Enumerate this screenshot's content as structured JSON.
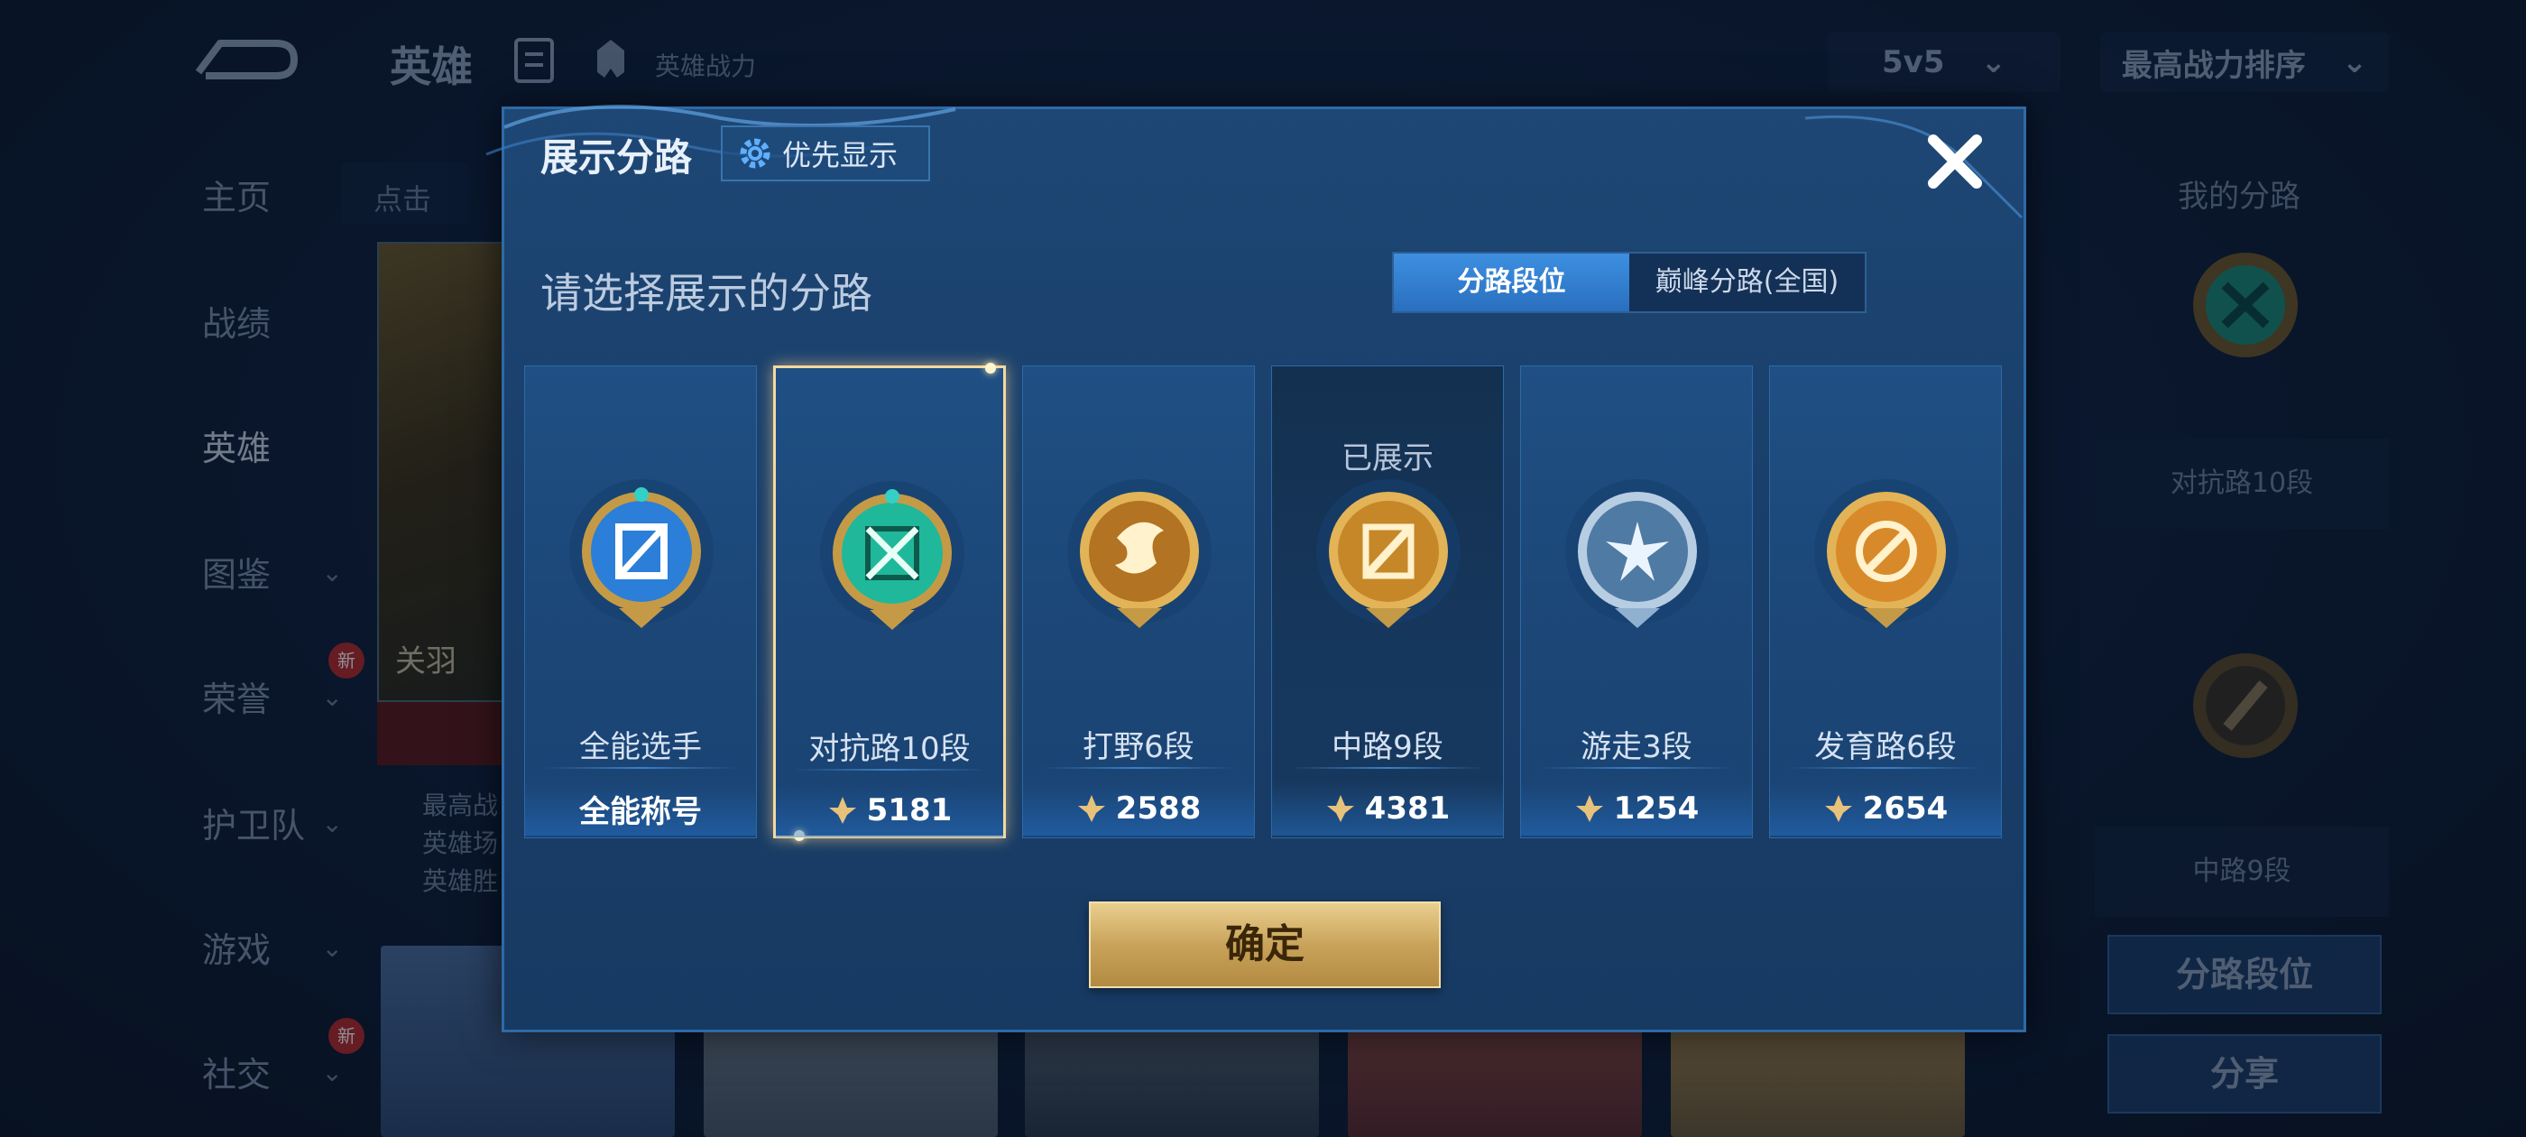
{
  "background": {
    "title": "英雄",
    "subtitle": "英雄战力",
    "mode_select": "5v5",
    "sort_select": "最高战力排序",
    "nav": [
      {
        "label": "主页",
        "has_chevron": false
      },
      {
        "label": "战绩",
        "has_chevron": false
      },
      {
        "label": "英雄",
        "has_chevron": false,
        "active": true
      },
      {
        "label": "图鉴",
        "has_chevron": true
      },
      {
        "label": "荣誉",
        "has_chevron": true,
        "badge": "新"
      },
      {
        "label": "护卫队",
        "has_chevron": true
      },
      {
        "label": "游戏",
        "has_chevron": true
      },
      {
        "label": "社交",
        "has_chevron": true,
        "badge": "新"
      }
    ],
    "search_stub": "点击",
    "hero_name": "关羽",
    "hero_stats": [
      "最高战",
      "英雄场",
      "英雄胜"
    ],
    "right_panel": {
      "title": "我的分路",
      "box1": "对抗路10段",
      "box2": "中路9段",
      "btn_rank": "分路段位",
      "btn_share": "分享"
    }
  },
  "modal": {
    "title": "展示分路",
    "priority_button": "优先显示",
    "subtitle": "请选择展示的分路",
    "tabs": [
      {
        "label": "分路段位",
        "active": true
      },
      {
        "label": "巅峰分路(全国)",
        "active": false
      }
    ],
    "cards": [
      {
        "name": "全能选手",
        "bottom_text": "全能称号",
        "has_score": false,
        "selected": false,
        "shown": false,
        "badge": "all-round-badge",
        "badge_color": "#2b7fd8"
      },
      {
        "name": "对抗路10段",
        "bottom_text": "5181",
        "has_score": true,
        "selected": true,
        "shown": false,
        "badge": "clash-lane-badge",
        "badge_color": "#1fb89a"
      },
      {
        "name": "打野6段",
        "bottom_text": "2588",
        "has_score": true,
        "selected": false,
        "shown": false,
        "badge": "jungle-badge",
        "badge_color": "#c98b2a"
      },
      {
        "name": "中路9段",
        "bottom_text": "4381",
        "has_score": true,
        "selected": false,
        "shown": true,
        "shown_tag": "已展示",
        "badge": "mid-lane-badge",
        "badge_color": "#d89a30"
      },
      {
        "name": "游走3段",
        "bottom_text": "1254",
        "has_score": true,
        "selected": false,
        "shown": false,
        "badge": "roam-badge",
        "badge_color": "#8fb0cf"
      },
      {
        "name": "发育路6段",
        "bottom_text": "2654",
        "has_score": true,
        "selected": false,
        "shown": false,
        "badge": "farm-lane-badge",
        "badge_color": "#d88a2a"
      }
    ],
    "confirm": "确定"
  }
}
